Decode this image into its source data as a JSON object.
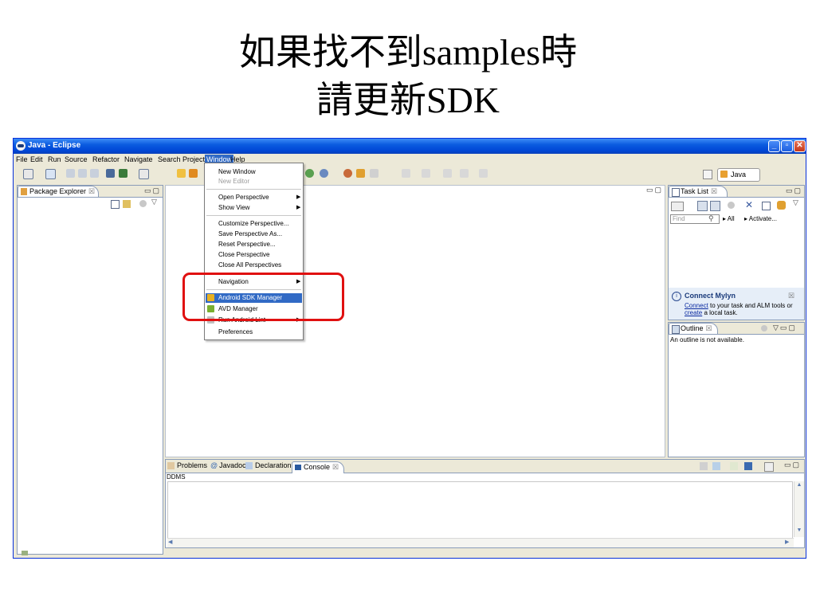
{
  "slide": {
    "title_line1": "如果找不到samples時",
    "title_line2": "請更新SDK"
  },
  "window": {
    "title": "Java - Eclipse",
    "controls": {
      "minimize": "_",
      "maximize": "▫",
      "close": "✕"
    }
  },
  "menubar": {
    "items": [
      "File",
      "Edit",
      "Run",
      "Source",
      "Refactor",
      "Navigate",
      "Search",
      "Project",
      "Window",
      "Help"
    ],
    "active": "Window"
  },
  "perspective": {
    "label": "Java"
  },
  "package_explorer": {
    "tab": "Package Explorer",
    "close": "☒"
  },
  "task_list": {
    "tab": "Task List",
    "close": "☒",
    "find_placeholder": "Find",
    "all_label": "All",
    "activate_label": "Activate..."
  },
  "mylyn": {
    "title": "Connect Mylyn",
    "close": "☒",
    "connect_link": "Connect",
    "text1": " to your task and ALM tools or",
    "create_link": "create",
    "text2": " a local task."
  },
  "outline": {
    "tab": "Outline",
    "close": "☒",
    "message": "An outline is not available."
  },
  "bottom_panel": {
    "tabs": [
      {
        "label": "Problems",
        "icon": "problems-icon"
      },
      {
        "label": "Javadoc",
        "icon": "javadoc-icon"
      },
      {
        "label": "Declaration",
        "icon": "declaration-icon"
      },
      {
        "label": "Console",
        "icon": "console-icon"
      }
    ],
    "console_close": "☒",
    "console_text": "DDMS"
  },
  "window_menu": {
    "items": [
      {
        "label": "New Window",
        "enabled": true
      },
      {
        "label": "New Editor",
        "enabled": false
      },
      {
        "label": "Open Perspective",
        "submenu": true
      },
      {
        "label": "Show View",
        "submenu": true
      },
      {
        "label": "Customize Perspective...",
        "enabled": true
      },
      {
        "label": "Save Perspective As...",
        "enabled": true
      },
      {
        "label": "Reset Perspective...",
        "enabled": true
      },
      {
        "label": "Close Perspective",
        "enabled": true
      },
      {
        "label": "Close All Perspectives",
        "enabled": true
      },
      {
        "label": "Navigation",
        "submenu": true
      },
      {
        "label": "Android SDK Manager",
        "selected": true,
        "icon": "android-sdk-manager-icon"
      },
      {
        "label": "AVD Manager",
        "icon": "avd-manager-icon"
      },
      {
        "label": "Run Android Lint",
        "submenu": true,
        "icon": "android-lint-icon"
      },
      {
        "label": "Preferences",
        "enabled": true
      }
    ]
  },
  "colors": {
    "highlight_box": "#e01010",
    "menu_selection": "#316ac5",
    "titlebar": "#0a5be0"
  }
}
